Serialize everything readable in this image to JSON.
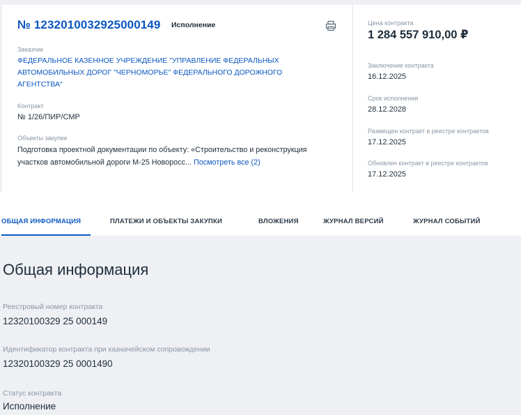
{
  "contract": {
    "number": "№ 1232010032925000149",
    "status": "Исполнение"
  },
  "customer": {
    "label": "Заказчик",
    "name": "ФЕДЕРАЛЬНОЕ КАЗЕННОЕ УЧРЕЖДЕНИЕ \"УПРАВЛЕНИЕ ФЕДЕРАЛЬНЫХ АВТОМОБИЛЬНЫХ ДОРОГ \"ЧЕРНОМОРЬЕ\" ФЕДЕРАЛЬНОГО ДОРОЖНОГО АГЕНТСТВА\""
  },
  "contract_ref": {
    "label": "Контракт",
    "value": "№ 1/26/ПИР/СМР"
  },
  "objects": {
    "label": "Объекты закупки",
    "text": "Подготовка проектной документации по объекту: «Строительство и реконструкция участков автомобильной дороги М-25 Новоросс... ",
    "more_link": "Посмотреть все (2)"
  },
  "summary": {
    "price_label": "Цена контракта",
    "price": "1 284 557 910,00 ₽",
    "conclusion_label": "Заключение контракта",
    "conclusion_date": "16.12.2025",
    "term_label": "Срок исполнения",
    "term_date": "28.12.2028",
    "placed_label": "Размещен контракт в реестре контрактов",
    "placed_date": "17.12.2025",
    "updated_label": "Обновлен контракт в реестре контрактов",
    "updated_date": "17.12.2025"
  },
  "tabs": [
    {
      "label": "ОБЩАЯ ИНФОРМАЦИЯ"
    },
    {
      "label": "ПЛАТЕЖИ И ОБЪЕКТЫ ЗАКУПКИ"
    },
    {
      "label": "ВЛОЖЕНИЯ"
    },
    {
      "label": "ЖУРНАЛ ВЕРСИЙ"
    },
    {
      "label": "ЖУРНАЛ СОБЫТИЙ"
    }
  ],
  "general": {
    "title": "Общая информация",
    "fields": [
      {
        "label": "Реестровый номер контракта",
        "value": "12320100329 25 000149"
      },
      {
        "label": "Идентификатор контракта при казначейском сопровождении",
        "value": "12320100329 25 0001490"
      },
      {
        "label": "Статус контракта",
        "value": "Исполнение"
      }
    ]
  },
  "colors": {
    "accent": "#0b57c1",
    "text": "#1f2d3a",
    "muted": "#8a96a3",
    "background": "#eef0f4"
  },
  "icons": {
    "print": "printer-icon"
  }
}
